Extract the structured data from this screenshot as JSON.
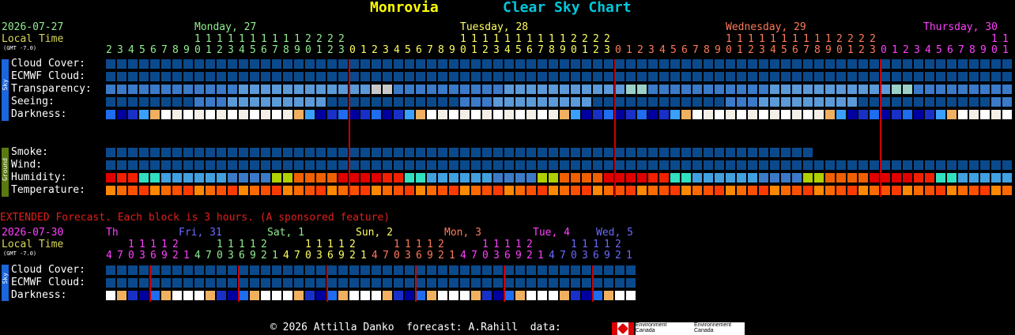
{
  "header": {
    "location": "Monrovia",
    "chart_name": "Clear Sky Chart"
  },
  "main": {
    "date": "2026-07-27",
    "local_time_label": "Local Time",
    "gmt_offset": "(GMT -7.0)",
    "days": [
      {
        "label": "Monday, 27",
        "color": "#90ee90"
      },
      {
        "label": "Tuesday, 28",
        "color": "#ffff60"
      },
      {
        "label": "Wednesday, 29",
        "color": "#ff7a5a"
      },
      {
        "label": "Thursday, 30",
        "color": "#ff40ff"
      }
    ],
    "hours_start": 2,
    "sky_label": "Sky",
    "ground_label": "Ground",
    "rows": [
      {
        "label": "Cloud Cover:",
        "group": "sky"
      },
      {
        "label": "ECMWF Cloud:",
        "group": "sky"
      },
      {
        "label": "Transparency:",
        "group": "sky"
      },
      {
        "label": "Seeing:",
        "group": "sky"
      },
      {
        "label": "Darkness:",
        "group": "sky"
      },
      {
        "label": "Smoke:",
        "group": "ground"
      },
      {
        "label": "Wind:",
        "group": "ground"
      },
      {
        "label": "Humidity:",
        "group": "ground"
      },
      {
        "label": "Temperature:",
        "group": "ground"
      }
    ]
  },
  "extended": {
    "banner": "EXTENDED Forecast. Each block is 3 hours. (A sponsored feature)",
    "date": "2026-07-30",
    "local_time_label": "Local Time",
    "gmt_offset": "(GMT -7.0)",
    "days": [
      {
        "label": "Th",
        "color": "#ff40ff"
      },
      {
        "label": "Fri, 31",
        "color": "#6a6aff"
      },
      {
        "label": "Sat, 1",
        "color": "#90ee90"
      },
      {
        "label": "Sun, 2",
        "color": "#ffff60"
      },
      {
        "label": "Mon, 3",
        "color": "#ff7a5a"
      },
      {
        "label": "Tue, 4",
        "color": "#ff40ff"
      },
      {
        "label": "Wed, 5",
        "color": "#6a6aff"
      }
    ],
    "sky_label": "Sky",
    "rows": [
      {
        "label": "Cloud Cover:"
      },
      {
        "label": "ECMWF Cloud:"
      },
      {
        "label": "Darkness:"
      }
    ]
  },
  "footer": {
    "copyright": "© 2026 Attilla Danko  forecast: A.Rahill  data:",
    "logo_text_1": "Environment\nCanada",
    "logo_text_2": "Environnement\nCanada"
  },
  "colors": {
    "label_yellow": "#d8d85a",
    "date_green": "#90ee90",
    "extended_red": "#e0201a",
    "sky_bar": "#1a66dd",
    "ground_bar": "#5a7a10",
    "vline": "#cc0000"
  }
}
